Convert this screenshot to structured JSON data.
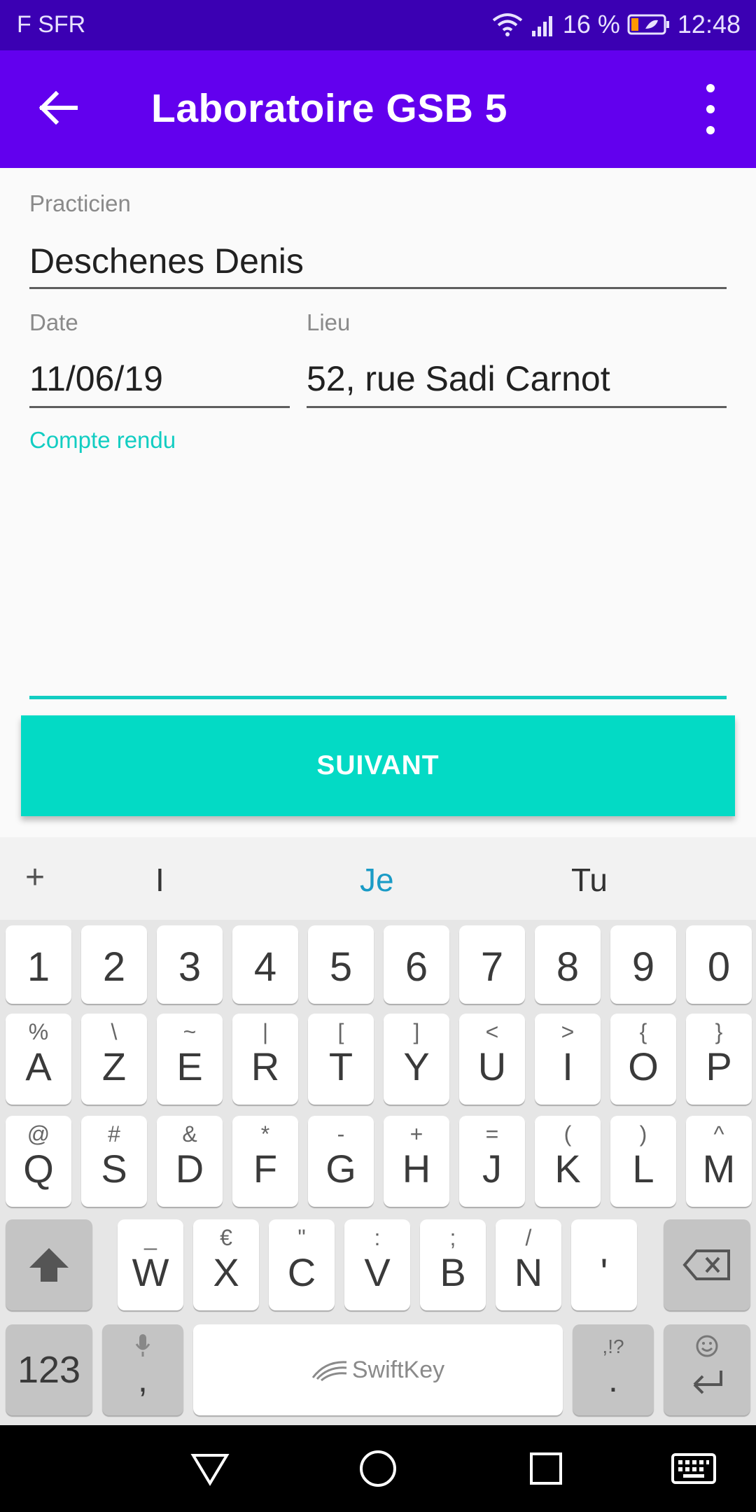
{
  "status": {
    "carrier": "F SFR",
    "battery_percent": "16 %",
    "time": "12:48"
  },
  "appbar": {
    "title": "Laboratoire GSB 5"
  },
  "form": {
    "practicien_label": "Practicien",
    "practicien_value": "Deschenes Denis",
    "date_label": "Date",
    "date_value": "11/06/19",
    "lieu_label": "Lieu",
    "lieu_value": "52, rue Sadi Carnot",
    "compte_rendu_label": "Compte rendu",
    "compte_rendu_value": ""
  },
  "button": {
    "suivant": "SUIVANT"
  },
  "keyboard": {
    "suggestion_plus": "+",
    "suggestions": [
      "I",
      "Je",
      "Tu"
    ],
    "number_row": [
      "1",
      "2",
      "3",
      "4",
      "5",
      "6",
      "7",
      "8",
      "9",
      "0"
    ],
    "row1": [
      {
        "main": "A",
        "alt": "%"
      },
      {
        "main": "Z",
        "alt": "\\"
      },
      {
        "main": "E",
        "alt": "~"
      },
      {
        "main": "R",
        "alt": "|"
      },
      {
        "main": "T",
        "alt": "["
      },
      {
        "main": "Y",
        "alt": "]"
      },
      {
        "main": "U",
        "alt": "<"
      },
      {
        "main": "I",
        "alt": ">"
      },
      {
        "main": "O",
        "alt": "{"
      },
      {
        "main": "P",
        "alt": "}"
      }
    ],
    "row2": [
      {
        "main": "Q",
        "alt": "@"
      },
      {
        "main": "S",
        "alt": "#"
      },
      {
        "main": "D",
        "alt": "&"
      },
      {
        "main": "F",
        "alt": "*"
      },
      {
        "main": "G",
        "alt": "-"
      },
      {
        "main": "H",
        "alt": "+"
      },
      {
        "main": "J",
        "alt": "="
      },
      {
        "main": "K",
        "alt": "("
      },
      {
        "main": "L",
        "alt": ")"
      },
      {
        "main": "M",
        "alt": "^"
      }
    ],
    "row3": [
      {
        "main": "W",
        "alt": "_"
      },
      {
        "main": "X",
        "alt": "€"
      },
      {
        "main": "C",
        "alt": "\""
      },
      {
        "main": "V",
        "alt": ":"
      },
      {
        "main": "B",
        "alt": ";"
      },
      {
        "main": "N",
        "alt": "/"
      },
      {
        "main": "'",
        "alt": ""
      }
    ],
    "symbols_key": "123",
    "comma_key": ",",
    "space_brand": "SwiftKey",
    "period_key": ".",
    "period_alt": ",!?"
  },
  "colors": {
    "status_bar": "#3b00b3",
    "app_bar": "#6200ee",
    "accent": "#03dac5"
  }
}
